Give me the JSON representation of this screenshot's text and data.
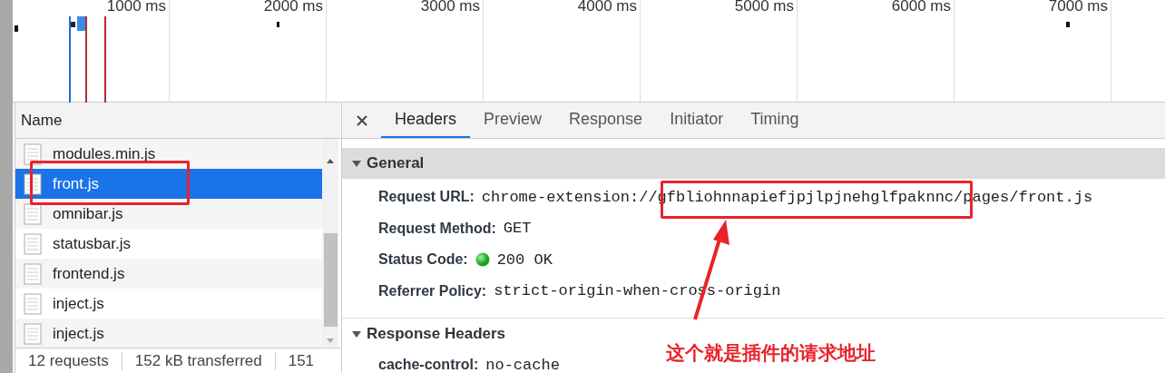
{
  "timeline": {
    "ticks": [
      "1000 ms",
      "2000 ms",
      "3000 ms",
      "4000 ms",
      "5000 ms",
      "6000 ms",
      "7000 ms"
    ]
  },
  "requests": {
    "column": "Name",
    "rows": [
      {
        "name": "modules.min.js",
        "selected": false
      },
      {
        "name": "front.js",
        "selected": true
      },
      {
        "name": "omnibar.js",
        "selected": false
      },
      {
        "name": "statusbar.js",
        "selected": false
      },
      {
        "name": "frontend.js",
        "selected": false
      },
      {
        "name": "inject.js",
        "selected": false
      },
      {
        "name": "inject.js",
        "selected": false
      }
    ]
  },
  "summary": [
    "12 requests",
    "152 kB transferred",
    "151"
  ],
  "detail": {
    "tabs": [
      {
        "label": "Headers",
        "selected": true
      },
      {
        "label": "Preview",
        "selected": false
      },
      {
        "label": "Response",
        "selected": false
      },
      {
        "label": "Initiator",
        "selected": false
      },
      {
        "label": "Timing",
        "selected": false
      }
    ],
    "sections": [
      {
        "title": "General",
        "expanded": true,
        "highlighted": true,
        "rows": [
          {
            "key": "Request URL:",
            "value": "chrome-extension://gfbliohnnapiefjpjlpjnehglfpaknnc/pages/front.js",
            "kind": "text"
          },
          {
            "key": "Request Method:",
            "value": "GET",
            "kind": "text"
          },
          {
            "key": "Status Code:",
            "value": "200 OK",
            "kind": "status"
          },
          {
            "key": "Referrer Policy:",
            "value": "strict-origin-when-cross-origin",
            "kind": "text"
          }
        ]
      },
      {
        "title": "Response Headers",
        "expanded": true,
        "highlighted": false,
        "rows": [
          {
            "key": "cache-control:",
            "value": "no-cache",
            "kind": "text"
          }
        ]
      }
    ]
  },
  "annotation": {
    "text": "这个就是插件的请求地址"
  }
}
